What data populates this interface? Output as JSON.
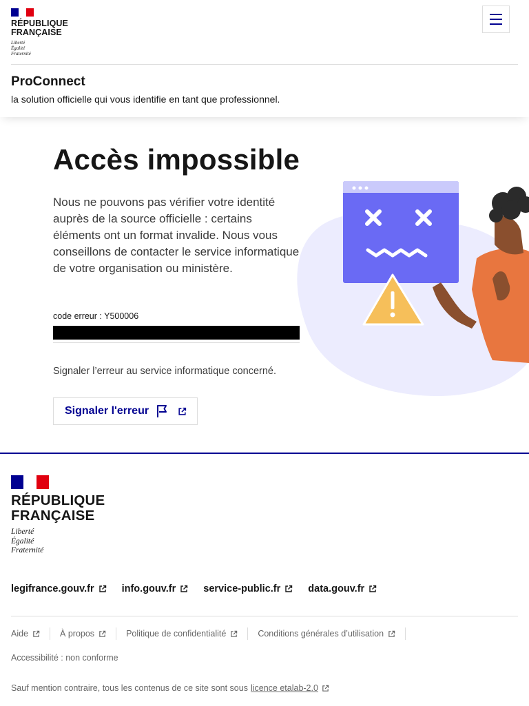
{
  "header": {
    "republic_line1": "RÉPUBLIQUE",
    "republic_line2": "FRANÇAISE",
    "motto": [
      "Liberté",
      "Égalité",
      "Fraternité"
    ],
    "service_title": "ProConnect",
    "service_tagline": "la solution officielle qui vous identifie en tant que professionnel.",
    "menu_icon": "hamburger-menu-icon"
  },
  "main": {
    "title": "Accès impossible",
    "description": "Nous ne pouvons pas vérifier votre identité auprès de la source officielle : certains éléments ont un format invalide. Nous vous conseillons de contacter le service informatique de votre organisation ou ministère.",
    "error_code": "code erreur : Y500006",
    "report_text": "Signaler l’erreur au service informatique concerné.",
    "report_button_label": "Signaler l'erreur"
  },
  "footer": {
    "republic_line1": "RÉPUBLIQUE",
    "republic_line2": "FRANÇAISE",
    "motto": [
      "Liberté",
      "Égalité",
      "Fraternité"
    ],
    "external_links": [
      "legifrance.gouv.fr",
      "info.gouv.fr",
      "service-public.fr",
      "data.gouv.fr"
    ],
    "bottom_links": [
      "Aide",
      "À propos",
      "Politique de confidentialité",
      "Conditions générales d’utilisation",
      "Accessibilité : non conforme"
    ],
    "copyright_prefix": "Sauf mention contraire, tous les contenus de ce site sont sous",
    "license_link": "licence etalab-2.0"
  },
  "colors": {
    "brand_blue": "#000091",
    "marianne_red": "#e1000f",
    "illustration_purple": "#6a6af4",
    "illustration_blob": "#ececfe",
    "warning_yellow": "#f6bf5a",
    "person_orange": "#e8763f"
  }
}
